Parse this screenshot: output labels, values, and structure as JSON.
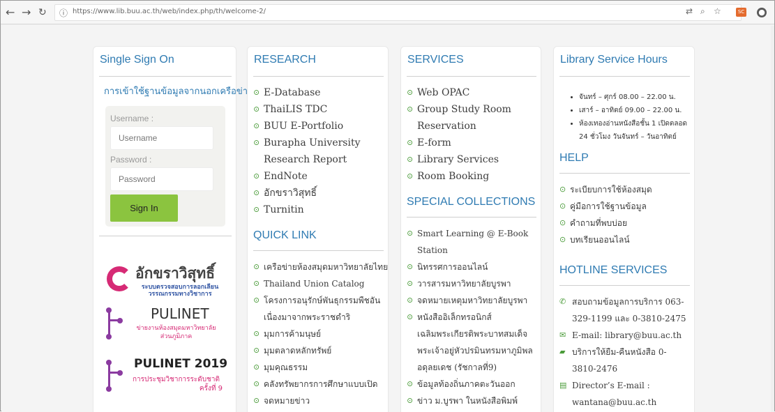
{
  "browser": {
    "url": "https://www.lib.buu.ac.th/web/index.php/th/welcome-2/",
    "nav_back_icon": "arrow-left-icon",
    "nav_forward_icon": "arrow-right-icon",
    "nav_reload_icon": "reload-icon",
    "info_icon": "info-icon",
    "toolbar": {
      "translate_icon": "translate-icon",
      "zoom_icon": "zoom-icon",
      "bookmark_icon": "star-icon",
      "extension_label": "SC",
      "profile_icon": "profile-icon"
    }
  },
  "sso": {
    "title": "Single Sign On",
    "external_access": "การเข้าใช้ฐานข้อมูลจากนอกเครือข่าย",
    "username_label": "Username :",
    "username_placeholder": "Username",
    "password_label": "Password :",
    "password_placeholder": "Password",
    "sign_in": "Sign In",
    "logos": [
      {
        "name": "อักขราวิสุทธิ์",
        "sub_1": "ระบบตรวจสอบการลอกเลียน",
        "sub_2": "วรรณกรรมทางวิชาการ"
      },
      {
        "name": "PULINET",
        "sub_1": "ข่ายงานห้องสมุดมหาวิทยาลัย",
        "sub_2": "ส่วนภูมิภาค"
      },
      {
        "name": "PULINET 2019",
        "sub_1": "การประชุมวิชาการระดับชาติ",
        "sub_2": "ครั้งที่ 9"
      }
    ]
  },
  "research": {
    "title": "RESEARCH",
    "items": [
      "E-Database",
      "ThaiLIS TDC",
      "BUU E-Portfolio",
      "Burapha University Research Report",
      "EndNote",
      "อักขราวิสุทธิ์",
      "Turnitin"
    ],
    "quick_title": "QUICK LINK",
    "quick_items": [
      "เครือข่ายห้องสมุดมหาวิทยาลัยไทย",
      "Thailand Union Catalog",
      "โครงการอนุรักษ์พันธุกรรมพืชอัน เนื่องมาจากพระราชดำริ",
      "มุมการค้ามนุษย์",
      "มุมตลาดหลักทรัพย์",
      "มุมคุณธรรม",
      "คลังทรัพยากรการศึกษาแบบเปิด",
      "จดหมายข่าว"
    ]
  },
  "services": {
    "title": "SERVICES",
    "items": [
      "Web OPAC",
      "Group Study Room Reservation",
      "E-form",
      "Library Services",
      "Room Booking"
    ],
    "special_title": "SPECIAL COLLECTIONS",
    "special_items": [
      "Smart Learning @ E-Book Station",
      "นิทรรศการออนไลน์",
      "วารสารมหาวิทยาลัยบูรพา",
      "จดหมายเหตุมหาวิทยาลัยบูรพา",
      "หนังสืออิเล็กทรอนิกส์ เฉลิมพระเกียรติพระบาทสมเด็จ พระเจ้าอยู่หัวปรมินทรมหาภูมิพล อดุลยเดช (รัชกาลที่9)",
      "ข้อมูลท้องถิ่นภาคตะวันออก",
      "ข่าว ม.บูรพา ในหนังสือพิมพ์"
    ]
  },
  "hours": {
    "title": "Library Service Hours",
    "items": [
      "จันทร์ – ศุกร์ 08.00 – 22.00 น.",
      "เสาร์ – อาทิตย์ 09.00 – 22.00 น.",
      "ห้องเทองอ่านหนังสือชั้น 1 เปิดตลอด 24 ชั่วโมง วันจันทร์ – วันอาทิตย์"
    ],
    "help_title": "HELP",
    "help_items": [
      "ระเบียบการใช้ห้องสมุด",
      "คู่มือการใช้ฐานข้อมูล",
      "คำถามที่พบบ่อย",
      "บทเรียนออนไลน์"
    ],
    "hotline_title": "HOTLINE SERVICES",
    "hotline_items": [
      {
        "icon": "phone-icon",
        "text": "สอบถามข้อมูลการบริการ 063-329-1199 และ 0-3810-2475"
      },
      {
        "icon": "mail-icon",
        "text": "E-mail: library@buu.ac.th"
      },
      {
        "icon": "book-icon",
        "text": "บริการให้ยืม-คืนหนังสือ 0-3810-2476"
      },
      {
        "icon": "card-icon",
        "text": "Director’s E-mail : wantana@buu.ac.th"
      }
    ]
  },
  "colors": {
    "heading": "#2f7bb2",
    "bullet": "#4a9b39",
    "button": "#8bc43f",
    "pink": "#d62a75"
  }
}
